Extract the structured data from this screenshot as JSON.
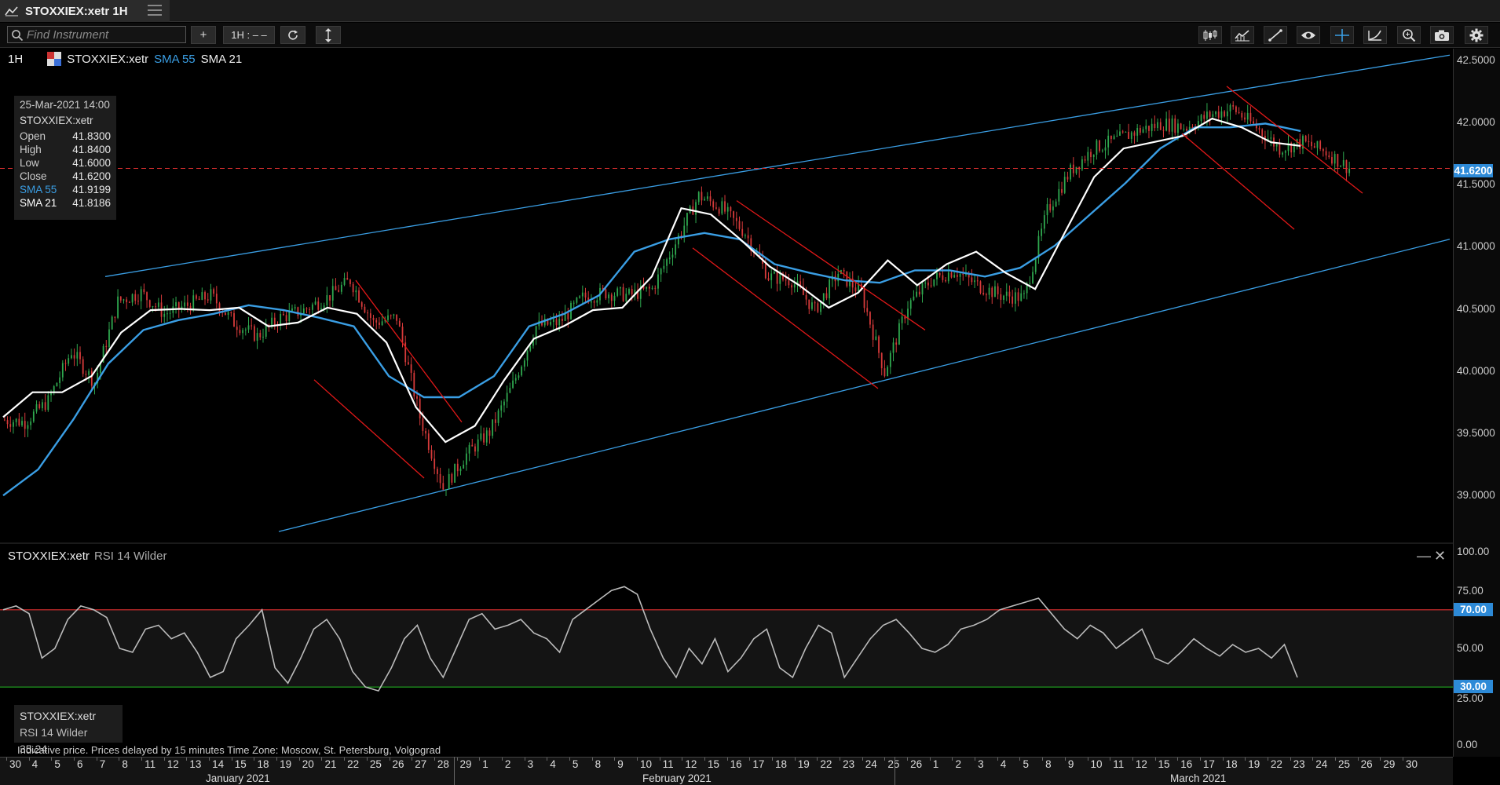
{
  "window": {
    "title": "STOXXIEX:xetr 1H"
  },
  "toolbar": {
    "search_placeholder": "Find Instrument",
    "add_label": "+",
    "interval_label": "1H : – –",
    "icons": [
      "candlestick-icon",
      "indicator-icon",
      "draw-line-icon",
      "eye-icon",
      "crosshair-icon",
      "curve-icon",
      "zoom-icon",
      "camera-icon",
      "gear-icon"
    ]
  },
  "legend": {
    "interval": "1H",
    "symbol": "STOXXIEX:xetr",
    "sma55": "SMA 55",
    "sma21": "SMA 21"
  },
  "infobox": {
    "date": "25-Mar-2021 14:00",
    "symbol": "STOXXIEX:xetr",
    "rows": [
      {
        "label": "Open",
        "value": "41.8300"
      },
      {
        "label": "High",
        "value": "41.8400"
      },
      {
        "label": "Low",
        "value": "41.6000"
      },
      {
        "label": "Close",
        "value": "41.6200"
      },
      {
        "label": "SMA 55",
        "value": "41.9199"
      },
      {
        "label": "SMA 21",
        "value": "41.8186"
      }
    ]
  },
  "rsi_panel": {
    "symbol": "STOXXIEX:xetr",
    "indicator": "RSI 14 Wilder",
    "box_symbol": "STOXXIEX:xetr",
    "box_value": "RSI 14 Wilder 35.24",
    "minimize": "—",
    "close": "✕"
  },
  "footnote": "Indicative price. Prices delayed by 15 minutes    Time Zone: Moscow, St. Petersburg, Volgograd",
  "colors": {
    "background": "#000000",
    "sma55": "#3a9ee4",
    "sma21": "#ffffff",
    "channel": "#3a9ee4",
    "downtrend": "#e01818",
    "candle_up": "#2fa84f",
    "candle_down": "#d63a3a",
    "rsi": "#bbbbbb",
    "rsi_upper": "#e03030",
    "rsi_lower": "#22b022",
    "last_price": "#e03030"
  },
  "chart_data": [
    {
      "type": "candlestick",
      "title": "STOXXIEX:xetr 1H",
      "x_ticks": [
        "30",
        "4",
        "5",
        "6",
        "7",
        "8",
        "11",
        "12",
        "13",
        "14",
        "15",
        "18",
        "19",
        "20",
        "21",
        "22",
        "25",
        "26",
        "27",
        "28",
        "29",
        "1",
        "2",
        "3",
        "4",
        "5",
        "8",
        "9",
        "10",
        "11",
        "12",
        "15",
        "16",
        "17",
        "18",
        "19",
        "22",
        "23",
        "24",
        "25",
        "26",
        "1",
        "2",
        "3",
        "4",
        "5",
        "8",
        "9",
        "10",
        "11",
        "12",
        "15",
        "16",
        "17",
        "18",
        "19",
        "22",
        "23",
        "24",
        "25",
        "26",
        "29",
        "30"
      ],
      "months": [
        "January 2021",
        "February 2021",
        "March 2021"
      ],
      "y_ticks": [
        "42.5000",
        "42.0000",
        "41.5000",
        "41.0000",
        "40.5000",
        "40.0000",
        "39.5000",
        "39.0000"
      ],
      "ylim": [
        38.72,
        42.6
      ],
      "last_price": "41.6200",
      "daily_closes": [
        39.58,
        39.75,
        40.15,
        39.9,
        40.55,
        40.62,
        40.45,
        40.52,
        40.6,
        40.38,
        40.27,
        40.42,
        40.48,
        40.58,
        40.72,
        40.38,
        40.42,
        39.62,
        39.05,
        39.32,
        39.5,
        39.88,
        40.35,
        40.38,
        40.58,
        40.62,
        40.6,
        40.65,
        41.02,
        41.4,
        41.3,
        41.1,
        40.75,
        40.72,
        40.48,
        40.78,
        40.62,
        39.98,
        40.52,
        40.72,
        40.8,
        40.68,
        40.6,
        40.58,
        41.28,
        41.6,
        41.78,
        41.85,
        41.93,
        41.98,
        41.95,
        42.05,
        42.1,
        41.95,
        41.78,
        41.83,
        41.75,
        41.62
      ],
      "sma21": [
        39.62,
        39.82,
        39.82,
        39.95,
        40.3,
        40.48,
        40.49,
        40.48,
        40.5,
        40.35,
        40.38,
        40.5,
        40.45,
        40.22,
        39.7,
        39.42,
        39.55,
        39.92,
        40.25,
        40.35,
        40.48,
        40.5,
        40.75,
        41.3,
        41.25,
        41.05,
        40.83,
        40.68,
        40.5,
        40.62,
        40.88,
        40.68,
        40.85,
        40.95,
        40.78,
        40.65,
        41.1,
        41.55,
        41.78,
        41.83,
        41.88,
        42.02,
        41.95,
        41.83,
        41.8
      ],
      "sma55": [
        38.99,
        39.2,
        39.6,
        40.05,
        40.32,
        40.4,
        40.45,
        40.52,
        40.48,
        40.42,
        40.35,
        39.95,
        39.78,
        39.78,
        39.95,
        40.35,
        40.45,
        40.6,
        40.95,
        41.05,
        41.1,
        41.05,
        40.85,
        40.78,
        40.72,
        40.7,
        40.8,
        40.8,
        40.75,
        40.82,
        41.0,
        41.25,
        41.5,
        41.78,
        41.95,
        41.95,
        41.98,
        41.92
      ],
      "channel_upper": [
        [
          40.75,
          42.53
        ]
      ],
      "channel_lower": [
        [
          38.7,
          41.05
        ]
      ],
      "downtrend_channels": [
        {
          "upper": [
            40.72,
            39.58
          ],
          "lower": [
            39.92,
            39.13
          ]
        },
        {
          "upper": [
            41.36,
            40.32
          ],
          "lower": [
            40.98,
            39.85
          ]
        },
        {
          "upper": [
            42.28,
            41.42
          ],
          "lower": [
            41.9,
            41.13
          ]
        }
      ]
    },
    {
      "type": "line",
      "title": "RSI 14 Wilder",
      "y_ticks": [
        "100.00",
        "75.00",
        "70.00",
        "50.00",
        "25.00",
        "30.00",
        "0.00"
      ],
      "ylim": [
        0,
        100
      ],
      "upper_level": "70.00",
      "lower_level": "30.00",
      "last_value": 35.24,
      "values": [
        70,
        72,
        68,
        45,
        50,
        65,
        72,
        70,
        66,
        50,
        48,
        60,
        62,
        55,
        58,
        48,
        35,
        38,
        55,
        62,
        70,
        40,
        32,
        45,
        60,
        65,
        55,
        38,
        30,
        28,
        40,
        55,
        62,
        45,
        35,
        50,
        65,
        68,
        60,
        62,
        65,
        58,
        55,
        48,
        65,
        70,
        75,
        80,
        82,
        78,
        60,
        45,
        35,
        50,
        42,
        55,
        38,
        45,
        55,
        60,
        40,
        35,
        50,
        62,
        58,
        35,
        45,
        55,
        62,
        65,
        58,
        50,
        48,
        52,
        60,
        62,
        65,
        70,
        72,
        74,
        76,
        68,
        60,
        55,
        62,
        58,
        50,
        55,
        60,
        45,
        42,
        48,
        55,
        50,
        46,
        52,
        48,
        50,
        45,
        52,
        35
      ]
    }
  ]
}
